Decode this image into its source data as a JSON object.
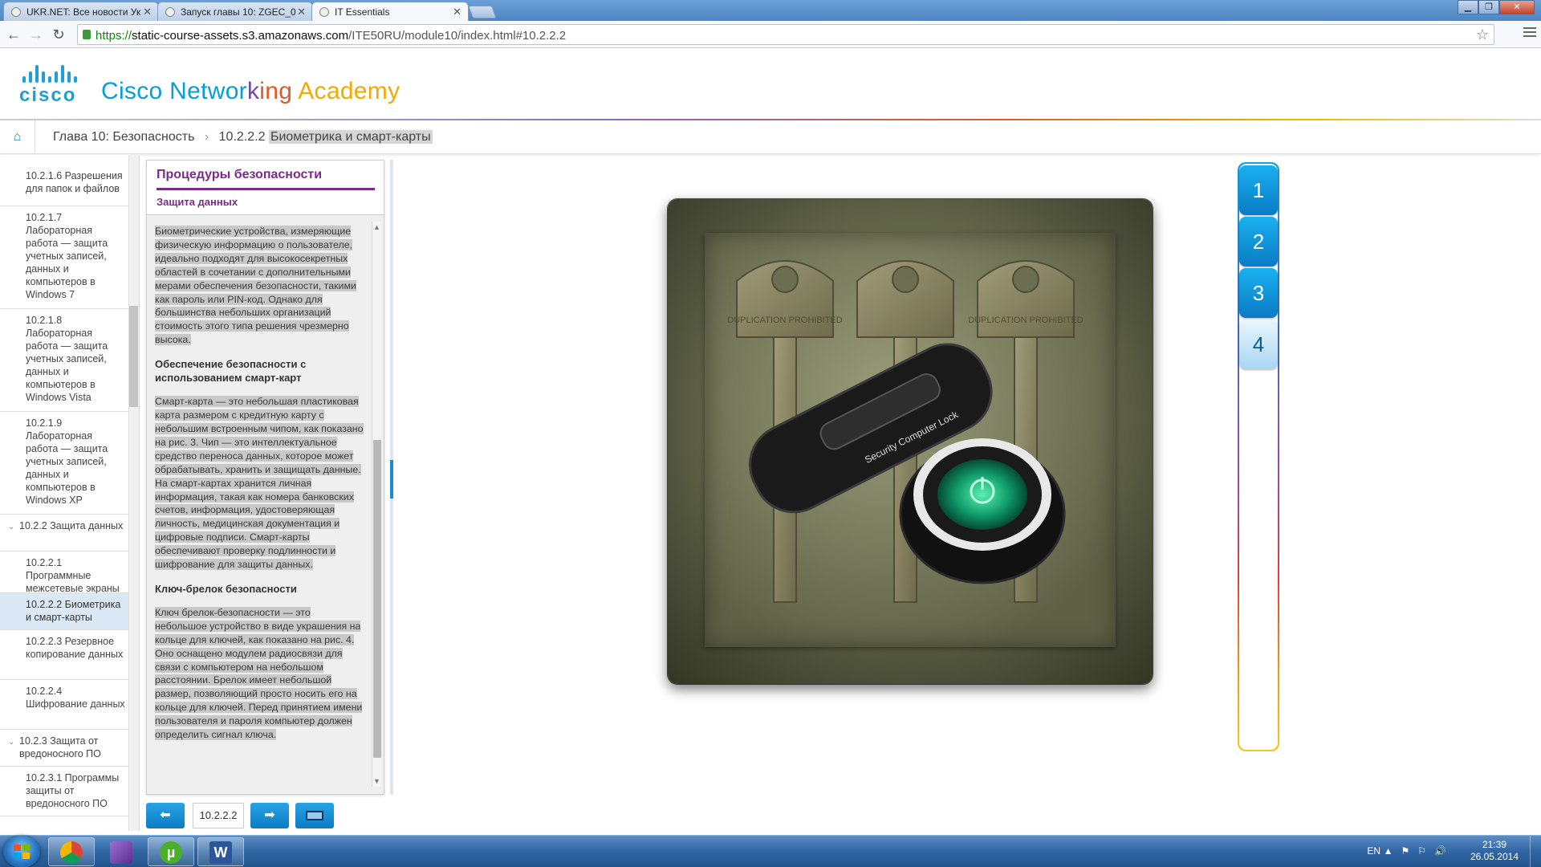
{
  "browser": {
    "tabs": [
      {
        "title": "UKR.NET: Все новости Ук"
      },
      {
        "title": "Запуск главы 10: ZGEC_0"
      },
      {
        "title": "IT Essentials"
      }
    ],
    "url_scheme": "https://",
    "url_host": "static-course-assets.s3.amazonaws.com",
    "url_path": "/ITE50RU/module10/index.html#10.2.2.2"
  },
  "header": {
    "logo_text": "CISCO",
    "title_part1": "Cisco Networ",
    "title_part2": "k",
    "title_part3": "ing ",
    "title_part4": "Academy"
  },
  "breadcrumb": {
    "chapter": "Глава 10: Безопасность",
    "separator": "›",
    "section_num": "10.2.2.2",
    "section_title": "Биометрика и смарт-карты"
  },
  "sidebar": {
    "items": [
      {
        "text": "10.2.1.6 Разрешения для папок и файлов"
      },
      {
        "text": "10.2.1.7 Лабораторная работа — защита учетных записей, данных и компьютеров в Windows 7"
      },
      {
        "text": "10.2.1.8 Лабораторная работа — защита учетных записей, данных и компьютеров в Windows Vista"
      },
      {
        "text": "10.2.1.9 Лабораторная работа — защита учетных записей, данных и компьютеров в Windows XP"
      },
      {
        "text": "10.2.2 Защита данных"
      },
      {
        "text": "10.2.2.1 Программные межсетевые экраны"
      },
      {
        "text": "10.2.2.2 Биометрика и смарт-карты"
      },
      {
        "text": "10.2.2.3 Резервное копирование данных"
      },
      {
        "text": "10.2.2.4 Шифрование данных"
      },
      {
        "text": "10.2.3 Защита от вредоносного ПО"
      },
      {
        "text": "10.2.3.1 Программы защиты от вредоносного ПО"
      }
    ]
  },
  "panel": {
    "title": "Процедуры безопасности",
    "subtitle": "Защита данных",
    "para1": "Биометрические устройства, измеряющие физическую информацию о пользователе, идеально подходят для высокосекретных областей в сочетании с дополнительными мерами обеспечения безопасности, такими как пароль или PIN-код. Однако для большинства небольших организаций стоимость этого типа решения чрезмерно высока.",
    "heading2": "Обеспечение безопасности с использованием смарт-карт",
    "para2": "Смарт-карта — это небольшая пластиковая карта размером с кредитную карту с небольшим встроенным чипом, как показано на рис. 3. Чип — это интеллектуальное средство переноса данных, которое может обрабатывать, хранить и защищать данные. На смарт-картах хранится личная информация, такая как номера банковских счетов, информация, удостоверяющая личность, медицинская документация и цифровые подписи. Смарт-карты обеспечивают проверку подлинности и шифрование для защиты данных.",
    "heading3": "Ключ-брелок безопасности",
    "para3": "Ключ брелок-безопасности — это небольшое устройство в виде украшения на кольце для ключей, как показано на рис. 4. Оно оснащено модулем радиосвязи для связи с компьютером на небольшом расстоянии. Брелок имеет небольшой размер, позволяющий просто носить его на кольце для ключей. Перед принятием имени пользователя и пароля компьютер должен определить сигнал ключа."
  },
  "bottom_nav": {
    "prev_icon": "arrow-left-icon",
    "page": "10.2.2.2",
    "next_icon": "arrow-right-icon",
    "media_icon": "media-icon"
  },
  "figure": {
    "stamp1": "DUPLICATION PROHIBITED",
    "stamp3": "DUPLICATION PROHIBITED",
    "device_label": "Security Computer Lock"
  },
  "figure_tabs": [
    {
      "label": "1"
    },
    {
      "label": "2"
    },
    {
      "label": "3"
    },
    {
      "label": "4"
    }
  ],
  "taskbar": {
    "lang": "EN",
    "time": "21:39",
    "date": "26.05.2014"
  },
  "colors": {
    "accent_blue": "#1a8ad4",
    "panel_purple": "#7b2a8c"
  }
}
